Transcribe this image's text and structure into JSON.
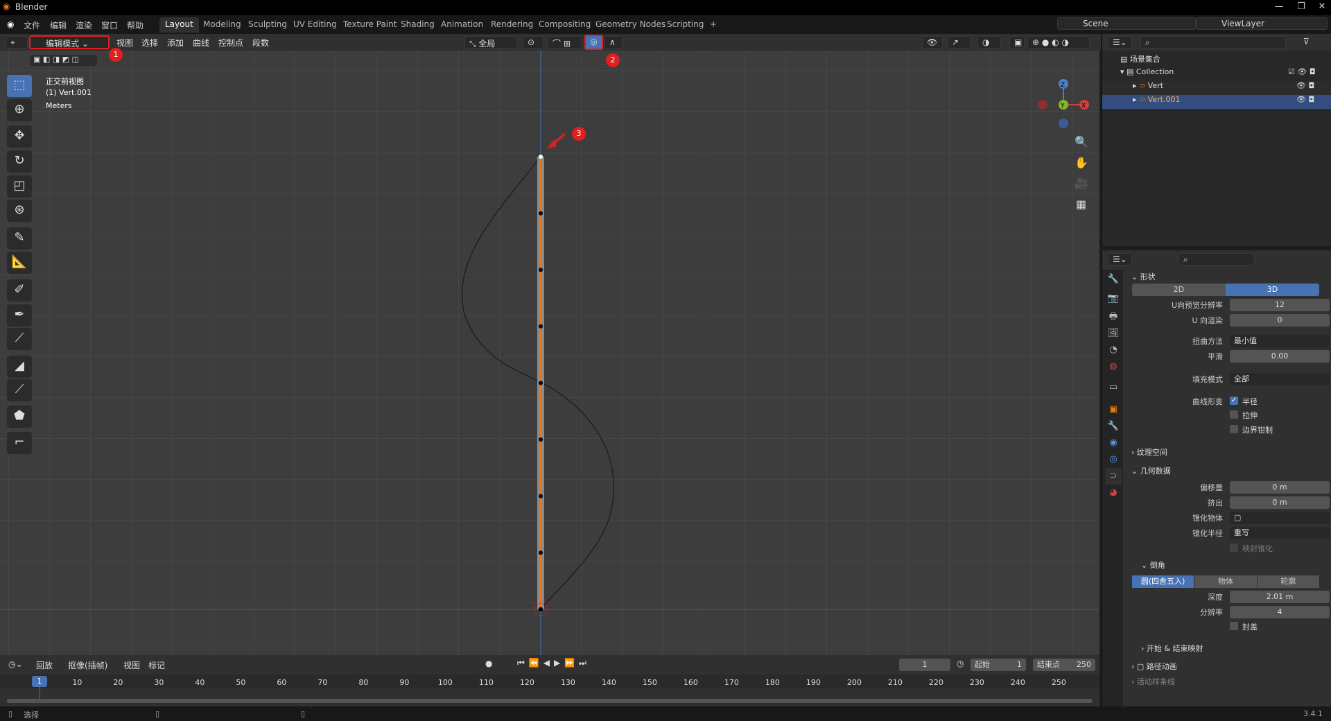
{
  "title": "Blender",
  "menu": [
    "文件",
    "编辑",
    "渲染",
    "窗口",
    "帮助"
  ],
  "workspaces": [
    "Layout",
    "Modeling",
    "Sculpting",
    "UV Editing",
    "Texture Paint",
    "Shading",
    "Animation",
    "Rendering",
    "Compositing",
    "Geometry Nodes",
    "Scripting",
    "+"
  ],
  "scene": "Scene",
  "view_layer": "ViewLayer",
  "header": {
    "mode": "编辑模式",
    "menus": [
      "视图",
      "选择",
      "添加",
      "曲线",
      "控制点",
      "段数"
    ],
    "transform_orientation": "全局"
  },
  "overlay": {
    "view": "正交前视图",
    "object": "(1) Vert.001",
    "units": "Meters"
  },
  "annotations": [
    "1",
    "2",
    "3"
  ],
  "gizmo": {
    "z": "Z",
    "y": "Y",
    "x": "X"
  },
  "outliner": {
    "root": "场景集合",
    "collection": "Collection",
    "items": [
      "Vert",
      "Vert.001"
    ]
  },
  "props": {
    "shape_title": "形状",
    "dim2": "2D",
    "dim3": "3D",
    "rows": [
      {
        "label": "U向预览分辨率",
        "value": "12"
      },
      {
        "label": "U 向渲染",
        "value": "0"
      },
      {
        "label": "扭曲方法",
        "value": "最小值"
      },
      {
        "label": "平滑",
        "value": "0.00"
      },
      {
        "label": "填充模式",
        "value": "全部"
      }
    ],
    "deform_label": "曲线形变",
    "deform": [
      {
        "label": "半径",
        "checked": true
      },
      {
        "label": "拉伸",
        "checked": false
      },
      {
        "label": "边界钳制",
        "checked": false
      }
    ],
    "texture_space": "纹理空间",
    "geometry": "几何数据",
    "geo_rows": [
      {
        "label": "偏移量",
        "value": "0 m"
      },
      {
        "label": "挤出",
        "value": "0 m"
      },
      {
        "label": "锥化物体",
        "value": ""
      },
      {
        "label": "锥化半径",
        "value": "重写"
      }
    ],
    "map_taper": "映射锥化",
    "bevel": "倒角",
    "bevel_modes": [
      "圆(四舍五入)",
      "物体",
      "轮廓"
    ],
    "bevel_rows": [
      {
        "label": "深度",
        "value": "2.01 m"
      },
      {
        "label": "分辨率",
        "value": "4"
      }
    ],
    "fill_caps": "封盖",
    "start_end": "开始 & 结束映射",
    "path_anim": "路径动画",
    "more": "活动样条线"
  },
  "timeline": {
    "playback": "回放",
    "keying": "抠像(插帧)",
    "view": "视图",
    "marker": "标记",
    "current": "1",
    "start_label": "起始",
    "start": "1",
    "end_label": "结束点",
    "end": "250",
    "ticks": [
      "10",
      "20",
      "30",
      "40",
      "50",
      "60",
      "70",
      "80",
      "90",
      "100",
      "110",
      "120",
      "130",
      "140",
      "150",
      "160",
      "170",
      "180",
      "190",
      "200",
      "210",
      "220",
      "230",
      "240",
      "250"
    ]
  },
  "status": {
    "select": "选择",
    "version": "3.4.1"
  }
}
